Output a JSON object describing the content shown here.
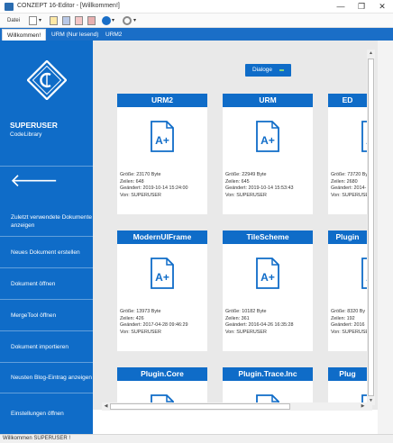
{
  "window": {
    "title": "CONZEPT 16-Editor - [Willkommen!]",
    "min": "—",
    "max": "❐",
    "close": "✕"
  },
  "toolbar": {
    "file_label": "Datei"
  },
  "tabs": [
    {
      "label": "Willkommen!"
    },
    {
      "label": "URM (Nur lesend)"
    },
    {
      "label": "URM2"
    }
  ],
  "sidebar": {
    "user": "SUPERUSER",
    "sub": "CodeLibrary",
    "back_arrow": "🡐",
    "items": [
      {
        "label": "Zuletzt verwendete Dokumente anzeigen"
      },
      {
        "label": "Neues Dokument erstellen"
      },
      {
        "label": "Dokument öffnen"
      },
      {
        "label": "MergeTool öffnen"
      },
      {
        "label": "Dokument importieren"
      },
      {
        "label": "Neusten Blog-Eintrag anzeigen"
      },
      {
        "label": "Einstellungen öffnen"
      }
    ]
  },
  "dialoge_button": {
    "label": "Dialoge"
  },
  "cards": [
    {
      "name": "URM2",
      "size": "Größe: 23170 Byte",
      "lines": "Zeilen: 648",
      "changed": "Geändert: 2019-10-14 15:24:00",
      "by": "Von: SUPERUSER"
    },
    {
      "name": "URM",
      "size": "Größe: 22949 Byte",
      "lines": "Zeilen: 645",
      "changed": "Geändert: 2019-10-14 15:53:43",
      "by": "Von: SUPERUSER"
    },
    {
      "name": "ED",
      "size": "Größe: 73720 Byte",
      "lines": "Zeilen: 2680",
      "changed": "Geändert: 2014-",
      "by": "Von: SUPERUSER"
    },
    {
      "name": "ModernUIFrame",
      "size": "Größe: 13973 Byte",
      "lines": "Zeilen: 426",
      "changed": "Geändert: 2017-04-28 09:46:29",
      "by": "Von: SUPERUSER"
    },
    {
      "name": "TileScheme",
      "size": "Größe: 10182 Byte",
      "lines": "Zeilen: 361",
      "changed": "Geändert: 2016-04-26 16:35:28",
      "by": "Von: SUPERUSER"
    },
    {
      "name": "Plugin",
      "size": "Größe: 8320 By",
      "lines": "Zeilen: 192",
      "changed": "Geändert: 2016",
      "by": "Von: SUPERUSER"
    },
    {
      "name": "Plugin.Core",
      "size": "",
      "lines": "",
      "changed": "",
      "by": ""
    },
    {
      "name": "Plugin.Trace.Inc",
      "size": "",
      "lines": "",
      "changed": "",
      "by": ""
    },
    {
      "name": "Plug",
      "size": "",
      "lines": "",
      "changed": "",
      "by": ""
    }
  ],
  "status": {
    "text": "Willkommen SUPERUSER !"
  },
  "colors": {
    "accent": "#0f6cc8"
  }
}
